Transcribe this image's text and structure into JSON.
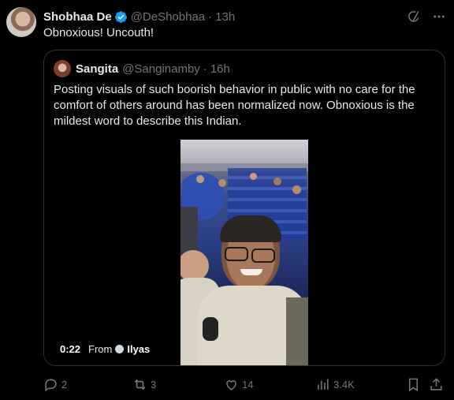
{
  "tweet": {
    "author_name": "Shobhaa De",
    "handle": "@DeShobhaa",
    "separator": "·",
    "time": "13h",
    "text": "Obnoxious! Uncouth!",
    "icons": [
      "grok-icon",
      "more-icon"
    ]
  },
  "quote": {
    "author_name": "Sangita",
    "handle": "@Sanginamby",
    "separator": "·",
    "time": "16h",
    "text": "Posting visuals of such boorish behavior in public with no care for the comfort of others around has been normalized now. Obnoxious is the mildest word to describe this Indian.",
    "video": {
      "duration": "0:22",
      "from_label": "From",
      "source": "Ilyas"
    }
  },
  "actions": {
    "replies": "2",
    "reposts": "3",
    "likes": "14",
    "views": "3.4K"
  },
  "colors": {
    "background": "#000000",
    "text": "#e7e9ea",
    "muted": "#71767b",
    "verified": "#1d9bf0",
    "border": "#2f3336"
  }
}
